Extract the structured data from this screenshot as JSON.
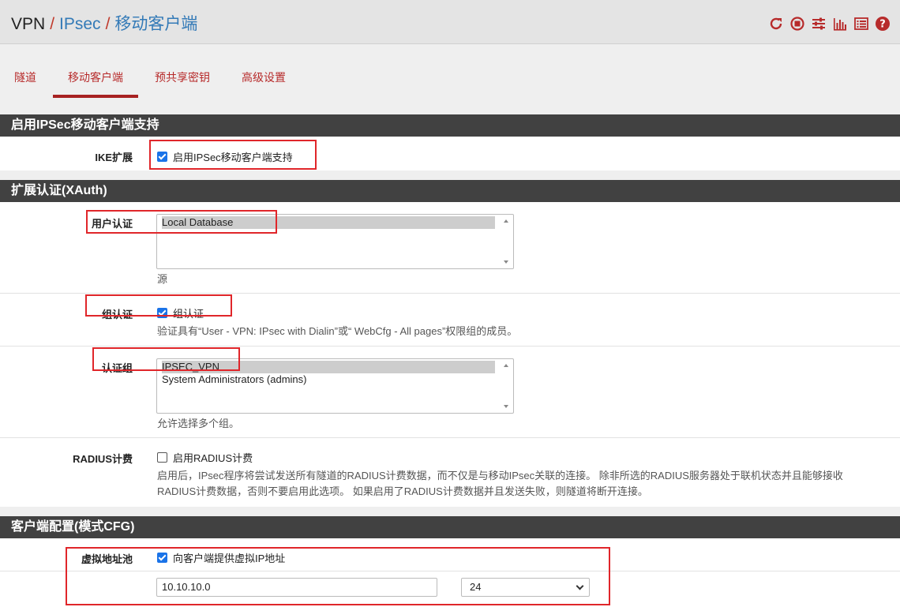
{
  "breadcrumb": {
    "vpn": "VPN",
    "ipsec": "IPsec",
    "current": "移动客户端",
    "sep": "/"
  },
  "header_icons": [
    "reload-icon",
    "stop-icon",
    "settings-sliders-icon",
    "chart-icon",
    "list-icon",
    "help-icon"
  ],
  "tabs": [
    "隧道",
    "移动客户端",
    "预共享密钥",
    "高级设置"
  ],
  "active_tab": "移动客户端",
  "sections": {
    "enable": {
      "title": "启用IPSec移动客户端支持",
      "ike_label": "IKE扩展",
      "ike_checkbox_label": "启用IPSec移动客户端支持",
      "ike_checked": true
    },
    "xauth": {
      "title": "扩展认证(XAuth)",
      "user_auth_label": "用户认证",
      "user_auth_options": [
        "Local Database"
      ],
      "user_auth_help": "源",
      "group_auth_label": "组认证",
      "group_auth_checkbox_label": "组认证",
      "group_auth_checked": true,
      "group_auth_help": "验证具有“User - VPN: IPsec with Dialin”或“ WebCfg - All pages”权限组的成员。",
      "auth_groups_label": "认证组",
      "auth_groups_options": [
        "IPSEC_VPN",
        "System Administrators (admins)"
      ],
      "auth_groups_help": "允许选择多个组。",
      "radius_label": "RADIUS计费",
      "radius_checkbox_label": "启用RADIUS计费",
      "radius_checked": false,
      "radius_help_line1": "启用后，IPsec程序将尝试发送所有隧道的RADIUS计费数据，而不仅是与移动IPsec关联的连接。 除非所选的RADIUS服务器处于联机状态并且能够接收",
      "radius_help_line2": "RADIUS计费数据，否则不要启用此选项。 如果启用了RADIUS计费数据并且发送失败，则隧道将断开连接。"
    },
    "modecfg": {
      "title": "客户端配置(模式CFG)",
      "pool_label": "虚拟地址池",
      "pool_checkbox_label": "向客户端提供虚拟IP地址",
      "pool_checked": true,
      "pool_address": "10.10.10.0",
      "pool_mask": "24"
    }
  },
  "colors": {
    "accent_red": "#b72b2b",
    "section_header": "#414141",
    "checkbox_blue": "#1a73e8",
    "link_blue": "#337ab7",
    "annotation_red": "#e0262a"
  }
}
